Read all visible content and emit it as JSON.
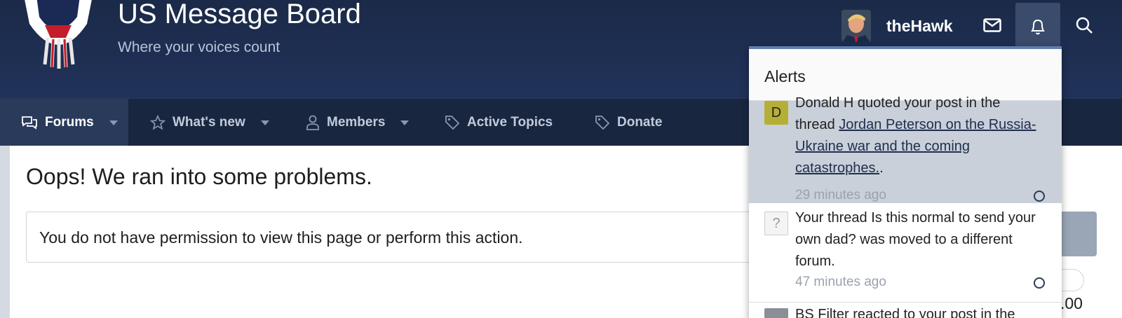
{
  "site": {
    "title": "US Message Board",
    "subtitle": "Where your voices count"
  },
  "user": {
    "name": "theHawk"
  },
  "nav": {
    "items": [
      {
        "label": "Forums",
        "icon": "comments-icon",
        "active": true,
        "caret": true
      },
      {
        "label": "What's new",
        "icon": "star-icon",
        "caret": true
      },
      {
        "label": "Members",
        "icon": "user-icon",
        "caret": true
      },
      {
        "label": "Active Topics",
        "icon": "tag-icon"
      },
      {
        "label": "Donate",
        "icon": "tag-icon"
      }
    ]
  },
  "main": {
    "error_title": "Oops! We ran into some problems.",
    "error_message": "You do not have permission to view this page or perform this action.",
    "partial_amount": ".00"
  },
  "alerts": {
    "title": "Alerts",
    "items": [
      {
        "avatar_letter": "D",
        "avatar_color": "#b5b035",
        "prefix": "Donald H quoted your post in the thread ",
        "link": "Jordan Peterson on the Russia-Ukraine war and the coming catastrophes.",
        "suffix": ".",
        "time": "29 minutes ago",
        "unread": true
      },
      {
        "avatar_letter": "?",
        "avatar_color": "#f0f0f0",
        "prefix": "Your thread Is this normal to send your own dad? was moved to a different forum.",
        "time": "47 minutes ago",
        "unread": false
      },
      {
        "avatar_letter": "",
        "prefix": "BS Filter reacted to your post in the",
        "time": "",
        "unread": false
      }
    ]
  },
  "colors": {
    "header_bg": "#1b2a48",
    "nav_bg": "#182640",
    "alerts_accent": "#5e7eaf",
    "unread_bg": "#c9d0da"
  }
}
